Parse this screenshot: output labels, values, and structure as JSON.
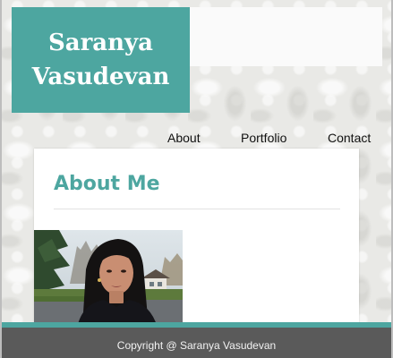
{
  "site": {
    "name_line1": "Saranya",
    "name_line2": "Vasudevan"
  },
  "nav": {
    "items": [
      {
        "label": "About"
      },
      {
        "label": "Portfolio"
      },
      {
        "label": "Contact"
      }
    ]
  },
  "main": {
    "section_title": "About Me"
  },
  "footer": {
    "copyright": "Copyright @ Saranya Vasudevan"
  },
  "colors": {
    "accent": "#4da6a0",
    "footer_bg": "#5a5a5a",
    "page_bg": "#e9e9e6"
  }
}
